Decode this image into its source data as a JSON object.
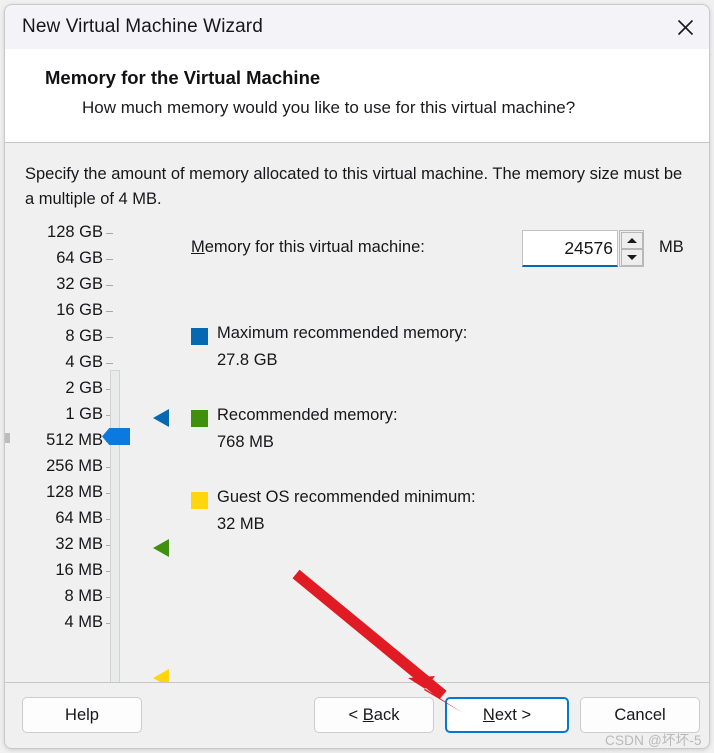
{
  "window": {
    "title": "New Virtual Machine Wizard",
    "close_icon": "close-icon"
  },
  "header": {
    "title": "Memory for the Virtual Machine",
    "subtitle": "How much memory would you like to use for this virtual machine?"
  },
  "content": {
    "intro": "Specify the amount of memory allocated to this virtual machine. The memory size must be a multiple of 4 MB."
  },
  "slider": {
    "ticks": [
      "128 GB",
      "64 GB",
      "32 GB",
      "16 GB",
      "8 GB",
      "4 GB",
      "2 GB",
      "1 GB",
      "512 MB",
      "256 MB",
      "128 MB",
      "64 MB",
      "32 MB",
      "16 MB",
      "8 MB",
      "4 MB"
    ],
    "thumb_value": "24576 MB",
    "thumb_color": "#0a7ae0",
    "markers": [
      {
        "name": "maximum-recommended-marker",
        "color": "#0568b0",
        "tick_index": 2
      },
      {
        "name": "recommended-marker",
        "color": "#3f900e",
        "tick_index": 7
      },
      {
        "name": "guest-os-minimum-marker",
        "color": "#fdd70c",
        "tick_index": 12
      }
    ]
  },
  "field": {
    "label": "Memory for this virtual machine:",
    "label_accel": "M",
    "label_rest": "emory for this virtual machine:",
    "value": "24576",
    "unit": "MB",
    "spinner_up_icon": "spinner-up-icon",
    "spinner_down_icon": "spinner-down-icon",
    "focus_color": "#0568b0"
  },
  "legend": [
    {
      "name": "maximum-recommended-memory",
      "color": "#0568b0",
      "label": "Maximum recommended memory:",
      "value": "27.8 GB"
    },
    {
      "name": "recommended-memory",
      "color": "#3f900e",
      "label": "Recommended memory:",
      "value": "768 MB"
    },
    {
      "name": "guest-os-recommended-minimum",
      "color": "#fdd70c",
      "label": "Guest OS recommended minimum:",
      "value": "32 MB"
    }
  ],
  "annotation": {
    "arrow_color": "#e01b24",
    "arrow_name": "red-pointer-arrow",
    "points_at": "Next >"
  },
  "footer": {
    "help": "Help",
    "back": "< Back",
    "back_accel": "B",
    "next": "Next >",
    "next_accel": "N",
    "cancel": "Cancel",
    "focused_button": "Next >",
    "focus_color": "#0078d4"
  },
  "watermark": {
    "text": "CSDN @坏坏-5"
  }
}
